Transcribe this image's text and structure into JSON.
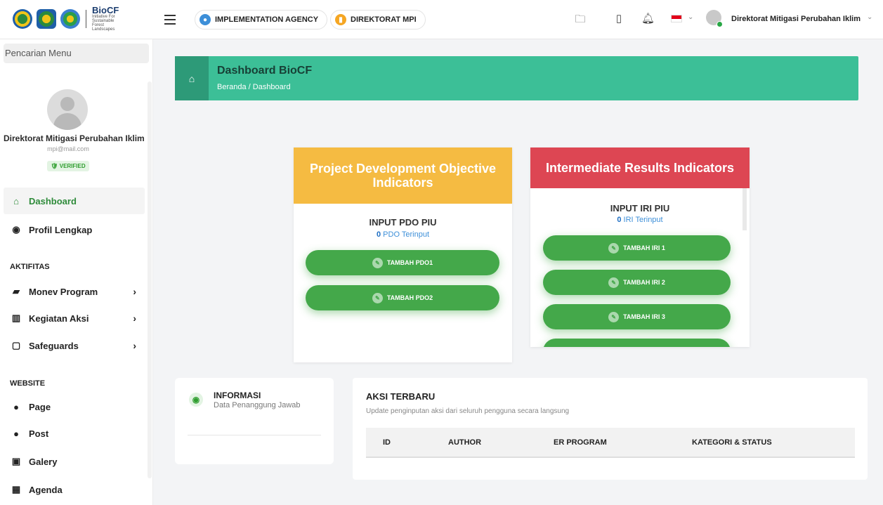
{
  "app": {
    "logo_text": "BioCF",
    "logo_sub": "Initiative For Sustainable Forest Landscapes"
  },
  "topbar": {
    "agency_label": "IMPLEMENTATION AGENCY",
    "direktorat_label": "DIREKTORAT MPI",
    "user_name": "Direktorat Mitigasi Perubahan Iklim"
  },
  "sidebar": {
    "search_label": "Pencarian Menu",
    "profile_name": "Direktorat Mitigasi Perubahan Iklim",
    "profile_email": "mpi@mail.com",
    "verified_label": "VERIFIED",
    "nav": [
      {
        "label": "Dashboard"
      },
      {
        "label": "Profil Lengkap"
      }
    ],
    "section_aktifitas": "AKTIFITAS",
    "aktifitas": [
      {
        "label": "Monev Program"
      },
      {
        "label": "Kegiatan Aksi"
      },
      {
        "label": "Safeguards"
      }
    ],
    "section_website": "WEBSITE",
    "website": [
      {
        "label": "Page"
      },
      {
        "label": "Post"
      },
      {
        "label": "Galery"
      },
      {
        "label": "Agenda"
      }
    ]
  },
  "header": {
    "title": "Dashboard BioCF",
    "breadcrumb": "Beranda / Dashboard"
  },
  "pdo": {
    "title": "Project Development Objective Indicators",
    "input_label": "INPUT PDO PIU",
    "count": "0",
    "count_suffix": " PDO Terinput",
    "buttons": [
      "TAMBAH PDO1",
      "TAMBAH PDO2"
    ],
    "color": "#f5bb42"
  },
  "iri": {
    "title": "Intermediate Results Indicators",
    "input_label": "INPUT IRI PIU",
    "count": "0",
    "count_suffix": " IRI Terinput",
    "buttons": [
      "TAMBAH IRI 1",
      "TAMBAH IRI 2",
      "TAMBAH IRI 3"
    ],
    "color": "#dd4653"
  },
  "informasi": {
    "title": "INFORMASI",
    "subtitle": "Data Penanggung Jawab"
  },
  "aksi": {
    "title": "AKSI TERBARU",
    "subtitle": "Update penginputan aksi dari seluruh pengguna secara langsung",
    "columns": [
      "ID",
      "AUTHOR",
      "ER PROGRAM",
      "KATEGORI & STATUS"
    ]
  },
  "colors": {
    "accent_green": "#3cbf97",
    "button_green": "#44a84a"
  }
}
